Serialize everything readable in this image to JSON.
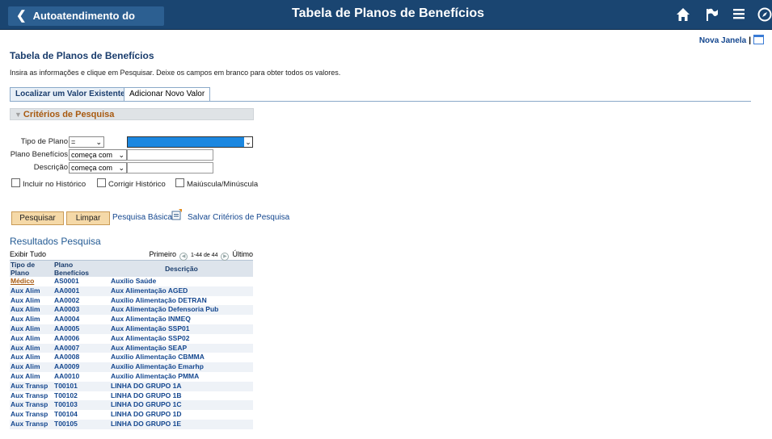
{
  "topbar": {
    "back_label": "Autoatendimento do Gerente",
    "title": "Tabela de Planos de Benefícios",
    "icons": [
      "home-icon",
      "flag-icon",
      "menu-icon",
      "compass-icon"
    ]
  },
  "new_window": {
    "label": "Nova Janela"
  },
  "page": {
    "title": "Tabela de Planos de Benefícios",
    "instructions": "Insira as informações e clique em Pesquisar. Deixe os campos em branco para obter todos os valores."
  },
  "tabs": {
    "find": "Localizar um Valor Existente",
    "add": "Adicionar Novo Valor"
  },
  "criteria": {
    "header": "Critérios de Pesquisa",
    "plan_type_label": "Tipo de Plano",
    "plan_type_operator": "=",
    "plan_type_value": "",
    "benefit_plan_label": "Plano Benefícios",
    "benefit_plan_operator": "começa com",
    "benefit_plan_value": "",
    "description_label": "Descrição",
    "description_operator": "começa com",
    "description_value": "",
    "include_history": "Incluir no Histórico",
    "correct_history": "Corrigir Histórico",
    "case_sensitive": "Maiúscula/Minúscula"
  },
  "actions": {
    "search": "Pesquisar",
    "clear": "Limpar",
    "basic_search": "Pesquisa Básica",
    "save_criteria": "Salvar Critérios de Pesquisa"
  },
  "results": {
    "title": "Resultados Pesquisa",
    "show_all": "Exibir Tudo",
    "first": "Primeiro",
    "range": "1-44 de 44",
    "last": "Último",
    "columns": [
      "Tipo de Plano",
      "Plano Benefícios",
      "Descrição"
    ],
    "rows": [
      [
        "Médico",
        "AS0001",
        "Auxílio Saúde"
      ],
      [
        "Aux Alim",
        "AA0001",
        "Aux Alimentação AGED"
      ],
      [
        "Aux Alim",
        "AA0002",
        "Auxílio Alimentação DETRAN"
      ],
      [
        "Aux Alim",
        "AA0003",
        "Aux Alimentação Defensoria Pub"
      ],
      [
        "Aux Alim",
        "AA0004",
        "Aux Alimentação INMEQ"
      ],
      [
        "Aux Alim",
        "AA0005",
        "Aux Alimentação SSP01"
      ],
      [
        "Aux Alim",
        "AA0006",
        "Aux Alimentação SSP02"
      ],
      [
        "Aux Alim",
        "AA0007",
        "Aux Alimentação SEAP"
      ],
      [
        "Aux Alim",
        "AA0008",
        "Auxílio Alimentação CBMMA"
      ],
      [
        "Aux Alim",
        "AA0009",
        "Auxílio Alimentação Emarhp"
      ],
      [
        "Aux Alim",
        "AA0010",
        "Auxílio Alimentação PMMA"
      ],
      [
        "Aux Transp",
        "T00101",
        "LINHA DO GRUPO 1A"
      ],
      [
        "Aux Transp",
        "T00102",
        "LINHA DO GRUPO 1B"
      ],
      [
        "Aux Transp",
        "T00103",
        "LINHA DO GRUPO 1C"
      ],
      [
        "Aux Transp",
        "T00104",
        "LINHA DO GRUPO 1D"
      ],
      [
        "Aux Transp",
        "T00105",
        "LINHA DO GRUPO 1E"
      ]
    ]
  }
}
